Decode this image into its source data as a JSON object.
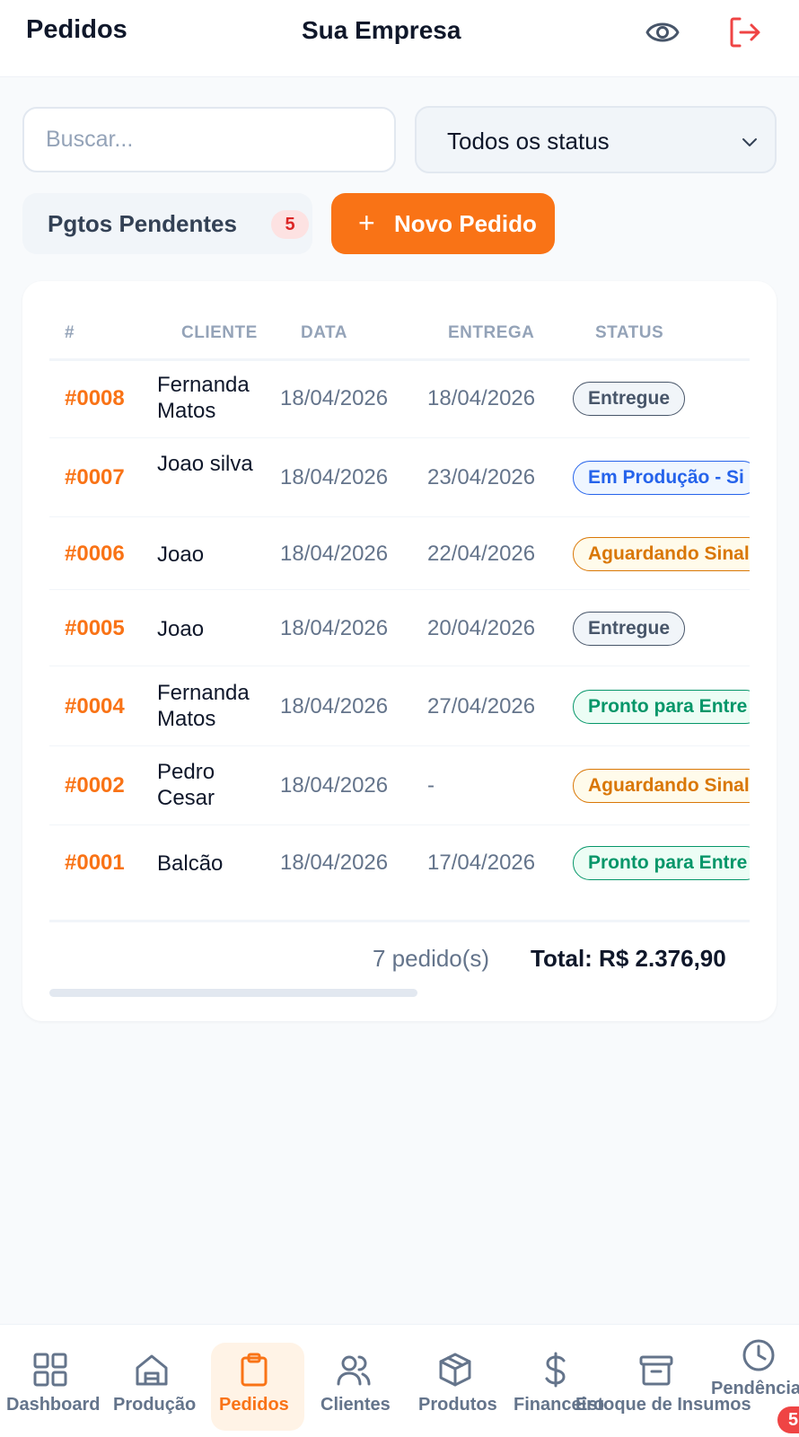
{
  "header": {
    "title": "Pedidos",
    "company": "Sua Empresa"
  },
  "filters": {
    "search_placeholder": "Buscar...",
    "status_selected": "Todos os status"
  },
  "actions": {
    "pending_label": "Pgtos Pendentes",
    "pending_count": "5",
    "new_order_plus": "+",
    "new_order_label": "Novo Pedido"
  },
  "table": {
    "columns": [
      "#",
      "CLIENTE",
      "DATA",
      "ENTREGA",
      "STATUS"
    ],
    "rows": [
      {
        "id": "#0008",
        "client": "Fernanda Matos",
        "date": "18/04/2026",
        "delivery": "18/04/2026",
        "status": "Entregue",
        "status_color": "gray"
      },
      {
        "id": "#0007",
        "client": "Joao silva",
        "date": "18/04/2026",
        "delivery": "23/04/2026",
        "status": "Em Produção - Si",
        "status_color": "blue"
      },
      {
        "id": "#0006",
        "client": "Joao",
        "date": "18/04/2026",
        "delivery": "22/04/2026",
        "status": "Aguardando Sinal",
        "status_color": "yellow"
      },
      {
        "id": "#0005",
        "client": "Joao",
        "date": "18/04/2026",
        "delivery": "20/04/2026",
        "status": "Entregue",
        "status_color": "gray"
      },
      {
        "id": "#0004",
        "client": "Fernanda Matos",
        "date": "18/04/2026",
        "delivery": "27/04/2026",
        "status": "Pronto para Entre",
        "status_color": "green"
      },
      {
        "id": "#0002",
        "client": "Pedro Cesar",
        "date": "18/04/2026",
        "delivery": "-",
        "status": "Aguardando Sinal",
        "status_color": "yellow"
      },
      {
        "id": "#0001",
        "client": "Balcão",
        "date": "18/04/2026",
        "delivery": "17/04/2026",
        "status": "Pronto para Entre",
        "status_color": "green"
      }
    ],
    "footer_count": "7 pedido(s)",
    "footer_total": "Total: R$ 2.376,90"
  },
  "nav": {
    "items": [
      {
        "label": "Dashboard",
        "icon": "grid-icon"
      },
      {
        "label": "Produção",
        "icon": "factory-icon"
      },
      {
        "label": "Pedidos",
        "icon": "clipboard-icon"
      },
      {
        "label": "Clientes",
        "icon": "users-icon"
      },
      {
        "label": "Produtos",
        "icon": "box-icon"
      },
      {
        "label": "Financeiro",
        "icon": "dollar-icon"
      },
      {
        "label": "Estoque de Insumos",
        "icon": "archive-icon"
      },
      {
        "label": "Pendências",
        "icon": "clock-icon"
      }
    ],
    "pending_badge": "5"
  },
  "colors": {
    "accent": "#f97316",
    "danger": "#dc2626"
  }
}
